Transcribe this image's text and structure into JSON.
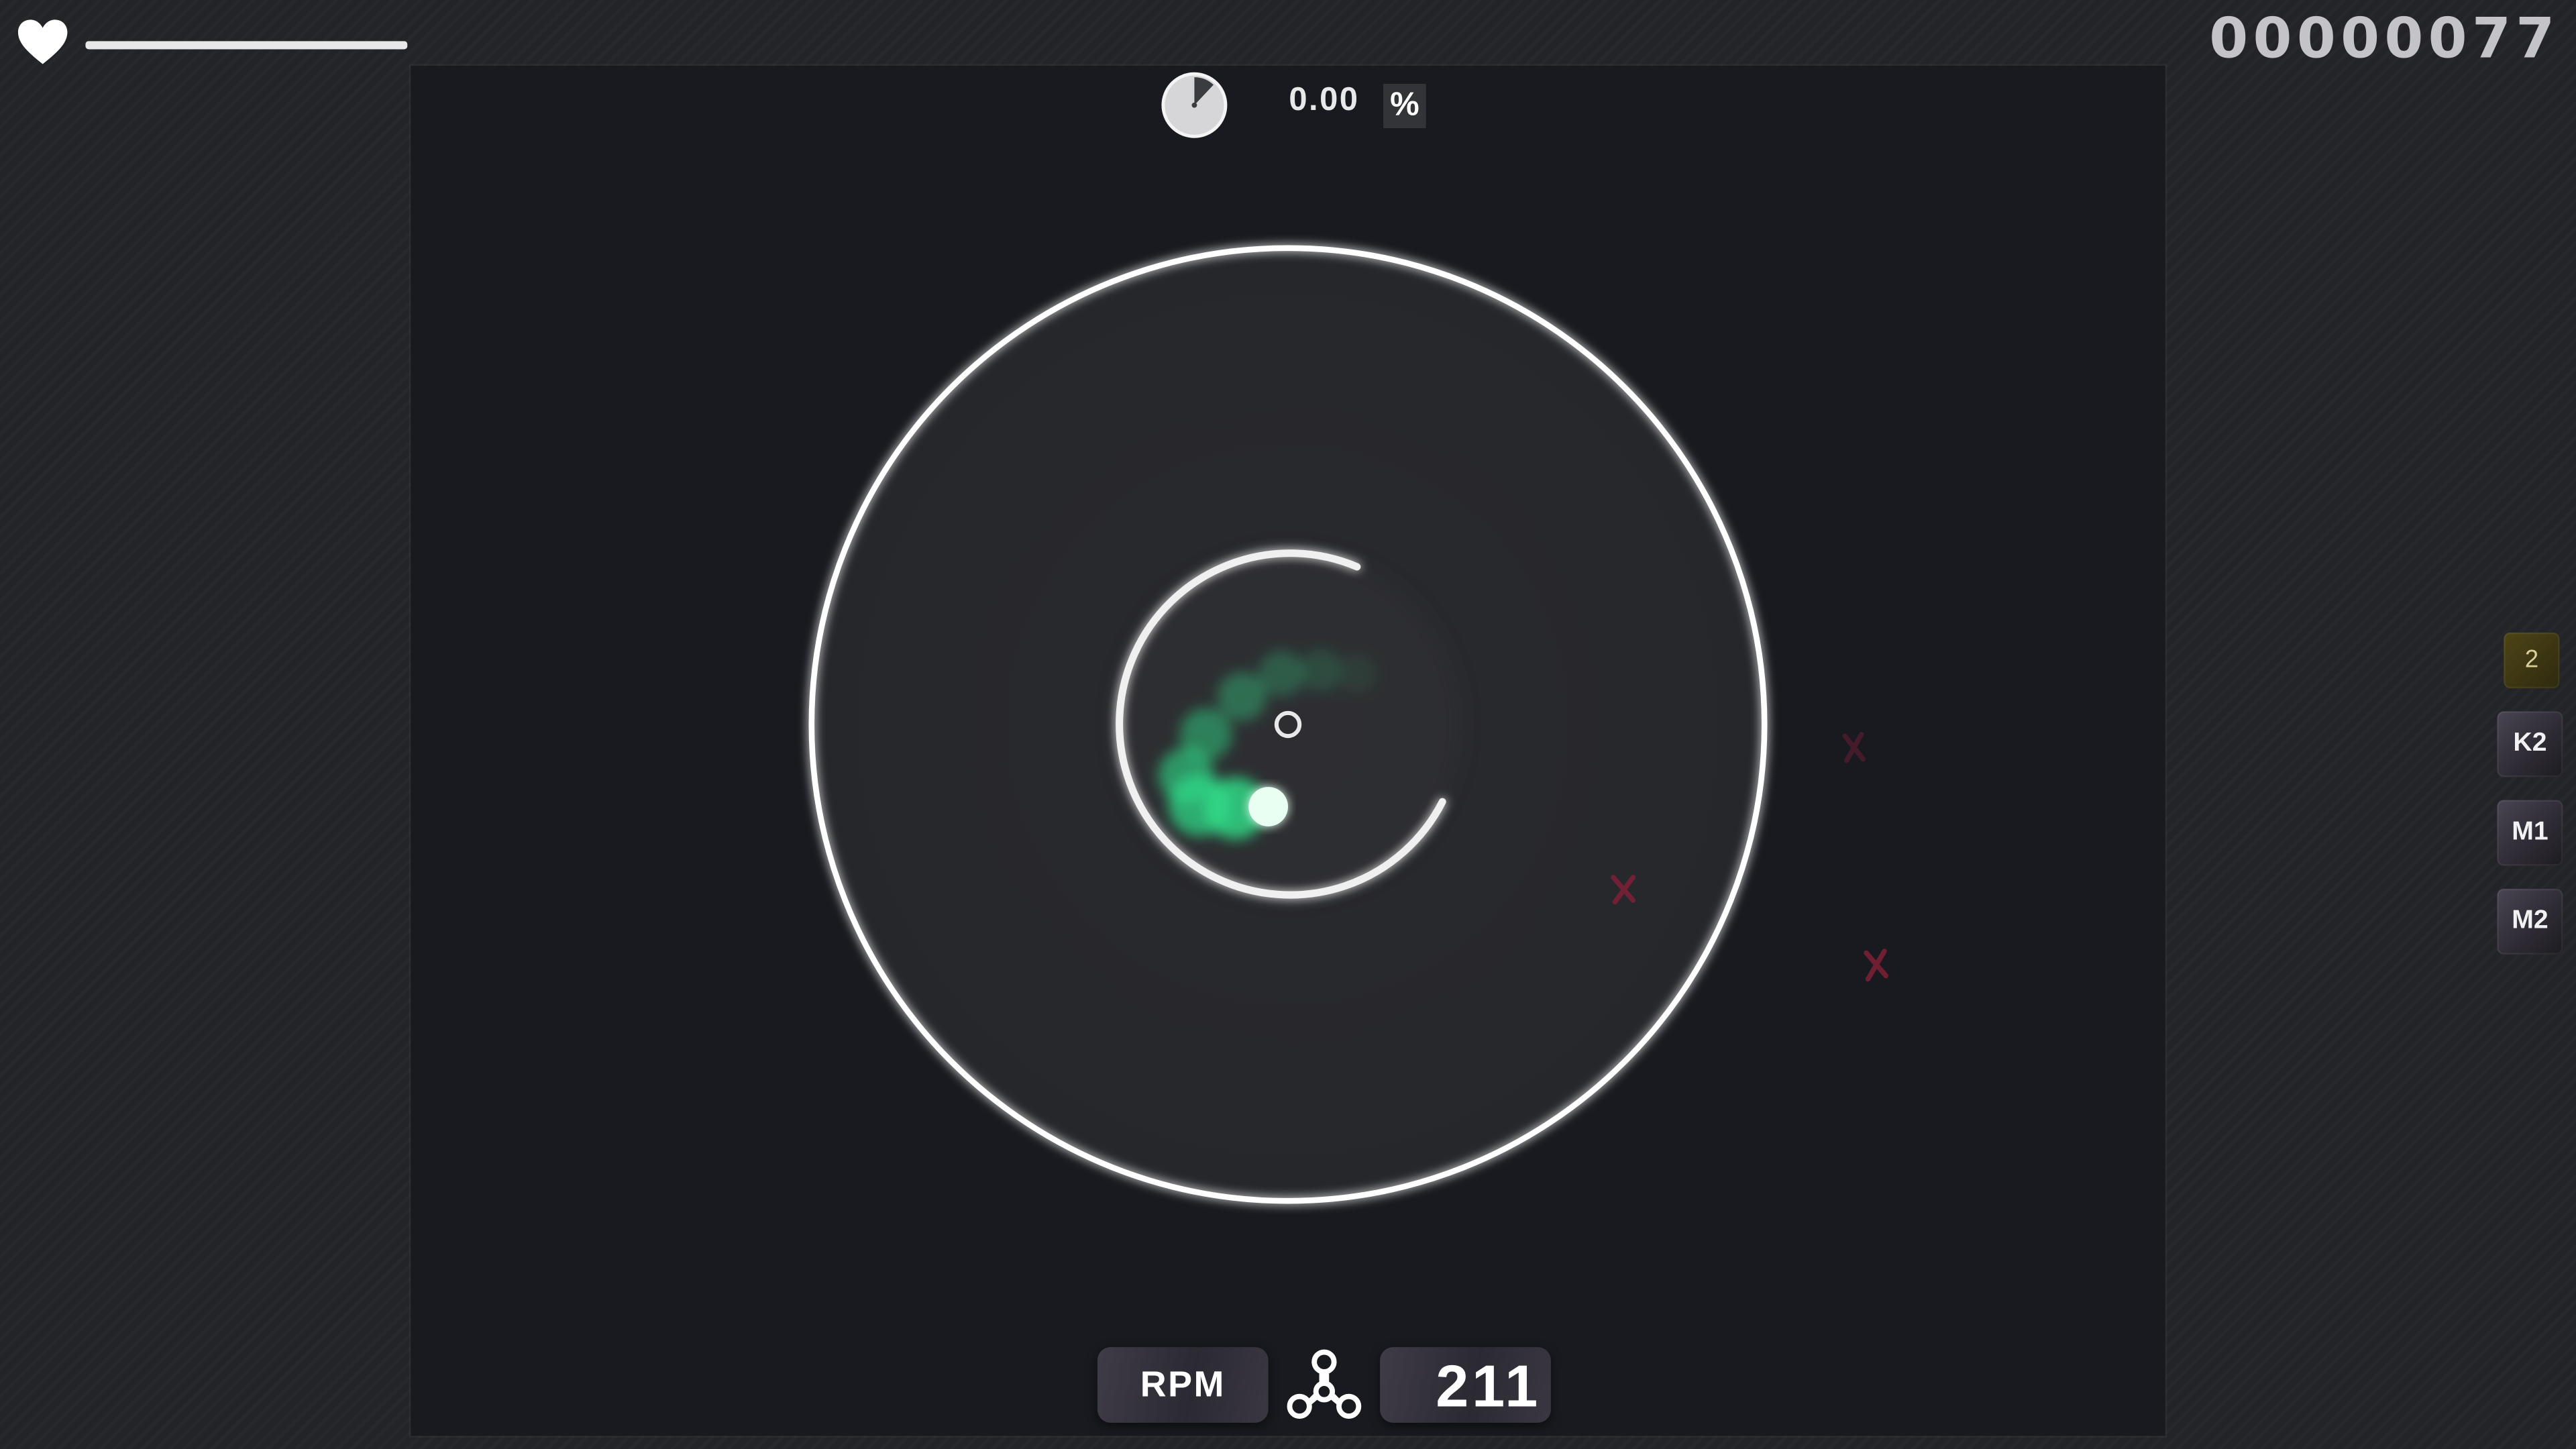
{
  "hud": {
    "health_fraction": 1.0,
    "score": "00000077",
    "progress_fraction": 0.12,
    "accuracy_value": "0.00",
    "accuracy_unit": "%"
  },
  "keys": [
    {
      "label": "2",
      "kind": "counter"
    },
    {
      "label": "K2",
      "kind": "key"
    },
    {
      "label": "M1",
      "kind": "key"
    },
    {
      "label": "M2",
      "kind": "key"
    }
  ],
  "rpm": {
    "label": "RPM",
    "value": "211"
  },
  "colors": {
    "cursor_trail": "#2fe08a",
    "miss_marker": "#7a2036",
    "ring": "#ffffff",
    "playfield": "#181a1f"
  },
  "icons": {
    "life": "heart-icon",
    "progress": "pie-progress-icon",
    "spinner": "fidget-spinner-icon",
    "miss": "x-mark-icon"
  }
}
